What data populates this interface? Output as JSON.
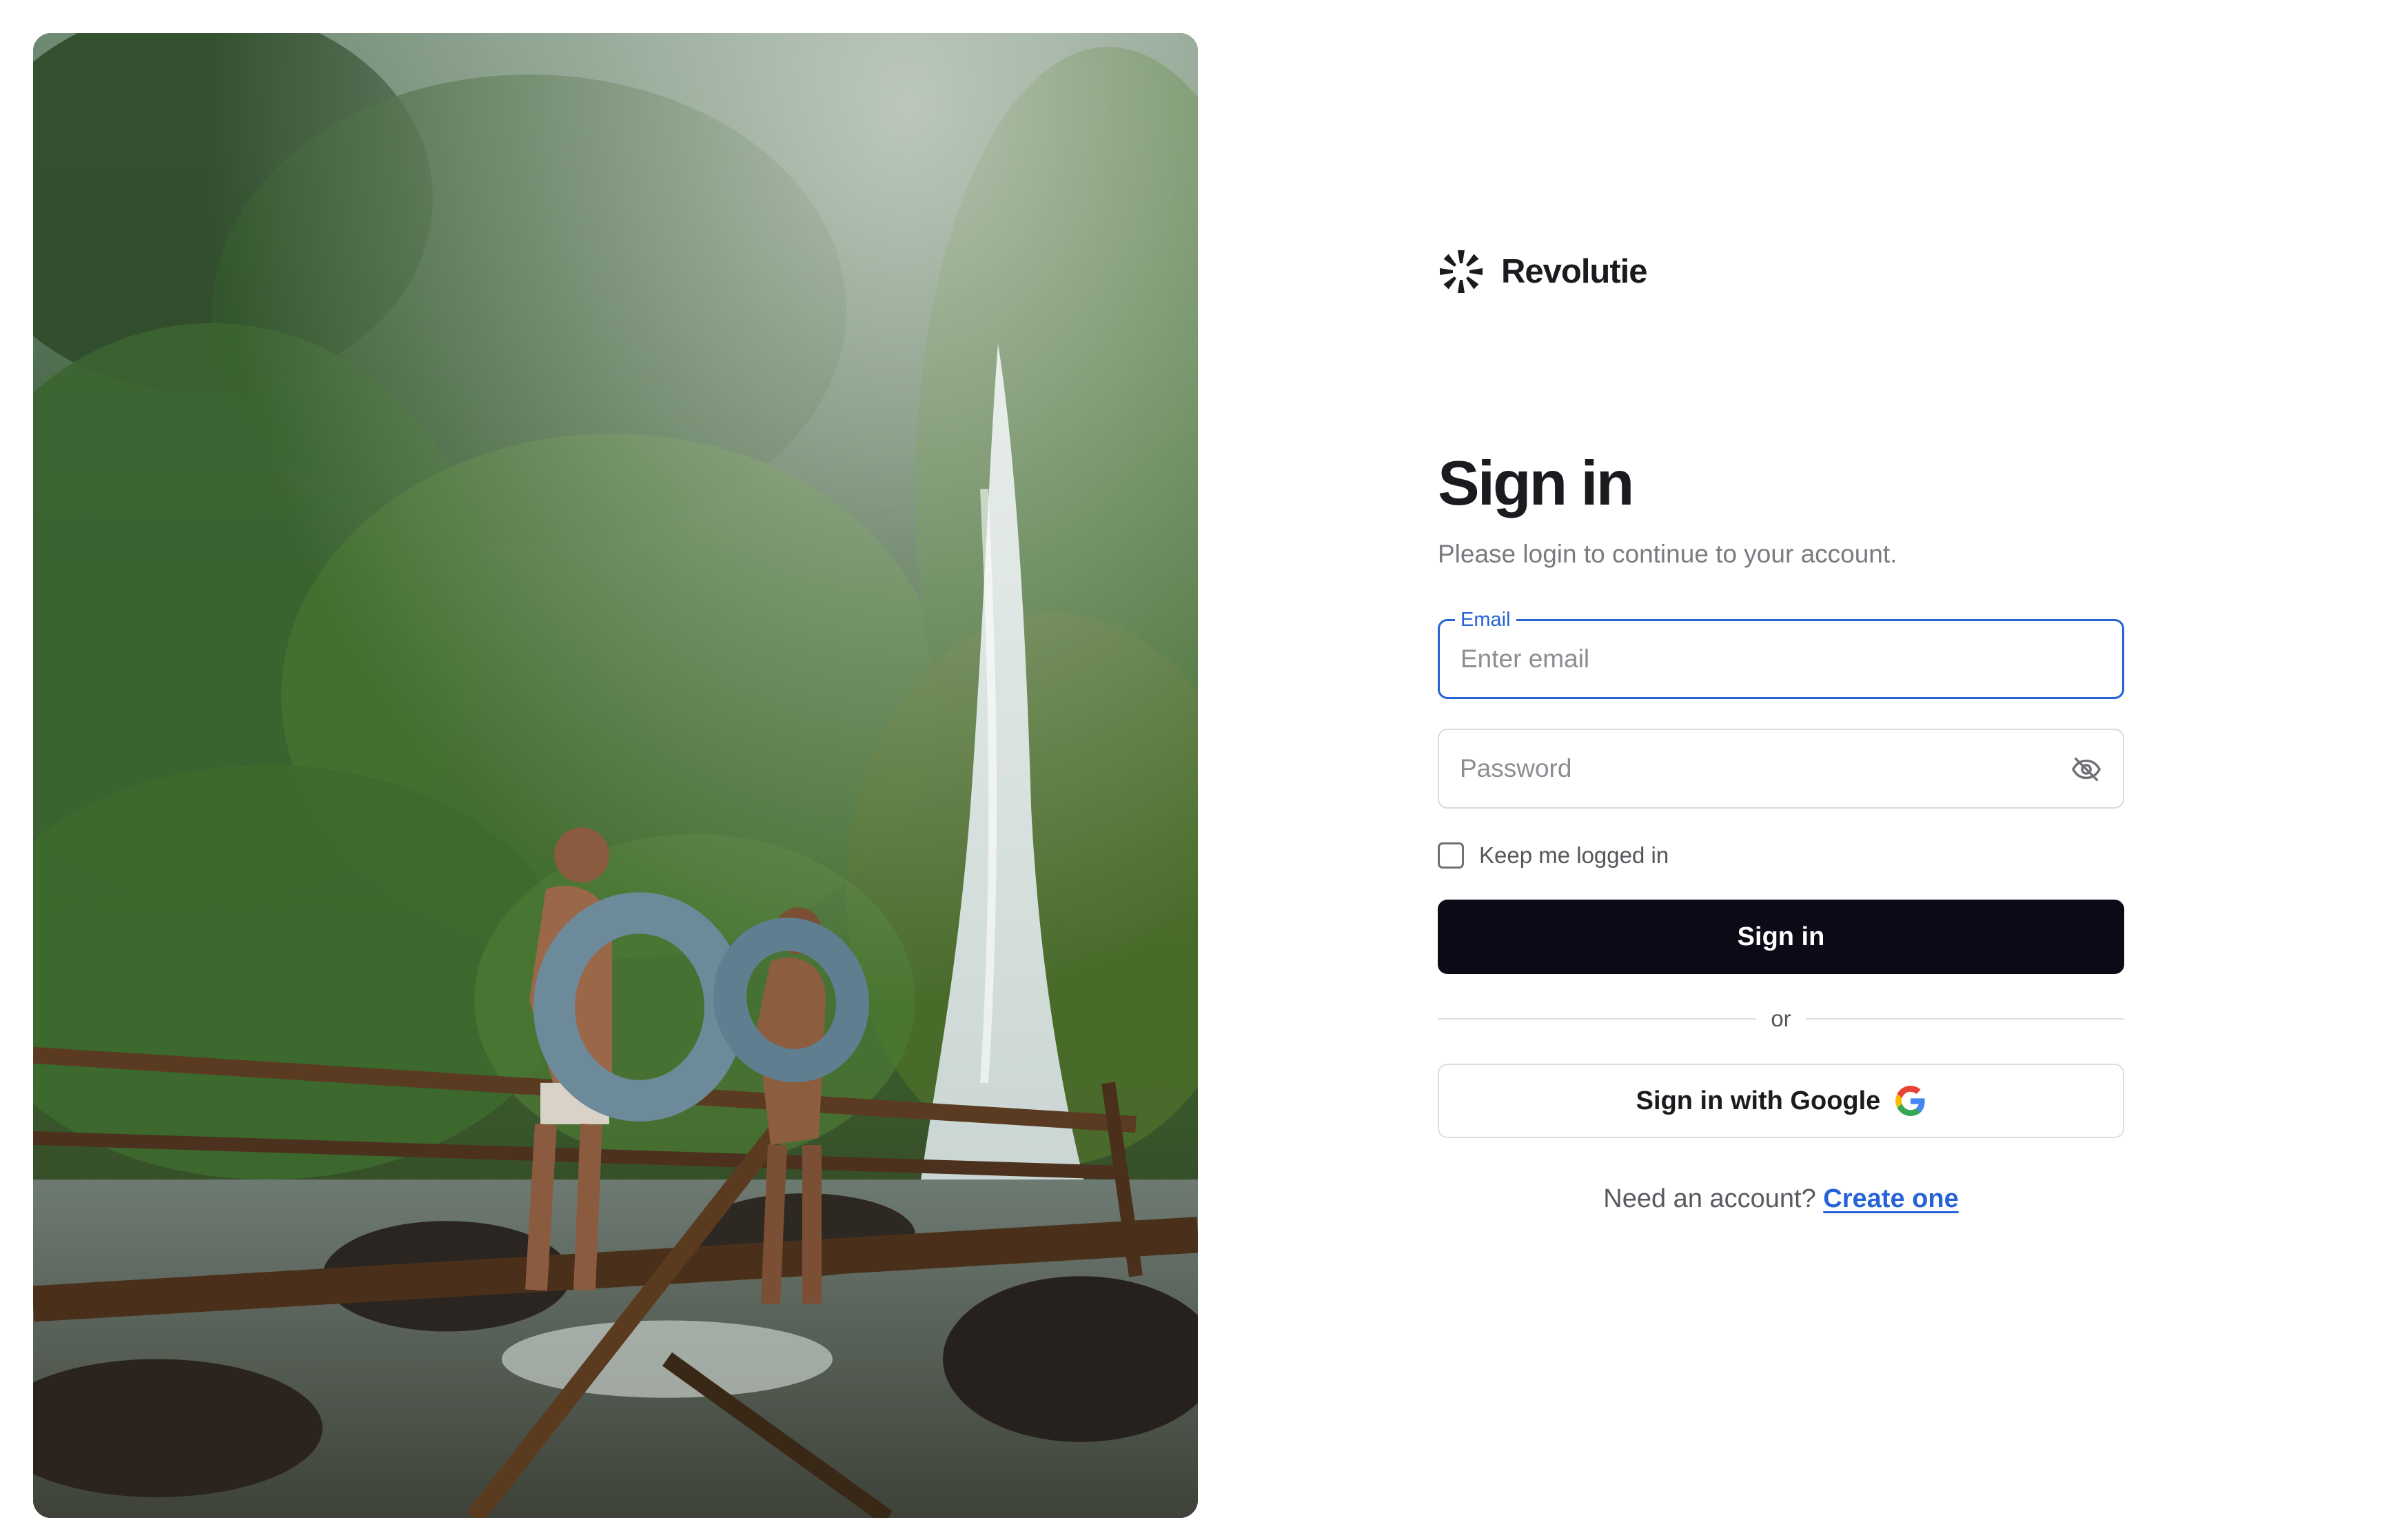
{
  "brand": {
    "name": "Revolutie"
  },
  "form": {
    "title": "Sign in",
    "subtitle": "Please login to continue to your account.",
    "email": {
      "label": "Email",
      "placeholder": "Enter email",
      "value": ""
    },
    "password": {
      "placeholder": "Password",
      "value": "",
      "toggle_icon": "eye-off-icon"
    },
    "remember": {
      "label": "Keep me logged in",
      "checked": false
    },
    "submit_label": "Sign in",
    "divider_label": "or",
    "google_label": "Sign in with Google",
    "footer": {
      "prompt": "Need an account?",
      "link_label": "Create one"
    }
  },
  "colors": {
    "accent": "#2563d6",
    "primary_button": "#0b0a16",
    "muted_text": "#7a7a80",
    "border": "#d9d9de"
  },
  "icons": [
    "revolutie-logo-icon",
    "eye-off-icon",
    "google-g-icon"
  ]
}
